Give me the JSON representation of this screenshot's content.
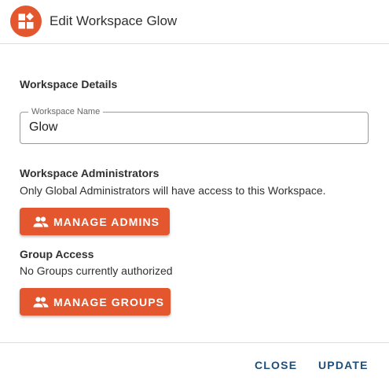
{
  "dialog": {
    "title": "Edit Workspace Glow",
    "header_icon": "workspace-widgets-icon"
  },
  "details": {
    "section_title": "Workspace Details",
    "name_field": {
      "label": "Workspace Name",
      "value": "Glow"
    }
  },
  "administrators": {
    "section_title": "Workspace Administrators",
    "description": "Only Global Administrators will have access to this Workspace.",
    "button_label": "MANAGE ADMINS",
    "button_icon": "people-icon"
  },
  "groups": {
    "section_title": "Group Access",
    "description": "No Groups currently authorized",
    "button_label": "MANAGE GROUPS",
    "button_icon": "people-icon"
  },
  "footer": {
    "close_label": "CLOSE",
    "update_label": "UPDATE"
  },
  "colors": {
    "accent": "#e4572e",
    "footer_text": "#1f4e79"
  }
}
